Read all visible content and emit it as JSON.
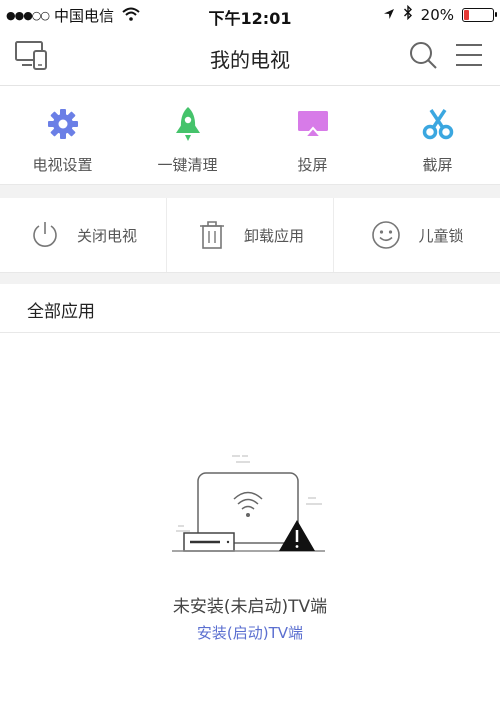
{
  "status_bar": {
    "signal": "●●●○○",
    "carrier": "中国电信",
    "time": "下午12:01",
    "battery_percent": "20%",
    "battery_level": 0.2,
    "battery_color": "#e53935"
  },
  "nav": {
    "title": "我的电视",
    "left_icon": "devices-icon",
    "right_icons": [
      "search-icon",
      "menu-icon"
    ]
  },
  "quick_actions": [
    {
      "label": "电视设置",
      "icon": "gear-icon",
      "color": "#6b7fe6"
    },
    {
      "label": "一键清理",
      "icon": "rocket-icon",
      "color": "#45c36b"
    },
    {
      "label": "投屏",
      "icon": "cast-screen-icon",
      "color": "#d77be8"
    },
    {
      "label": "截屏",
      "icon": "scissors-icon",
      "color": "#3ba7e0"
    }
  ],
  "controls": [
    {
      "label": "关闭电视",
      "icon": "power-icon"
    },
    {
      "label": "卸载应用",
      "icon": "trash-icon"
    },
    {
      "label": "儿童锁",
      "icon": "smiley-icon"
    }
  ],
  "section": {
    "title": "全部应用"
  },
  "empty_state": {
    "title": "未安装(未启动)TV端",
    "link": "安装(启动)TV端",
    "link_color": "#5b6fd0"
  }
}
